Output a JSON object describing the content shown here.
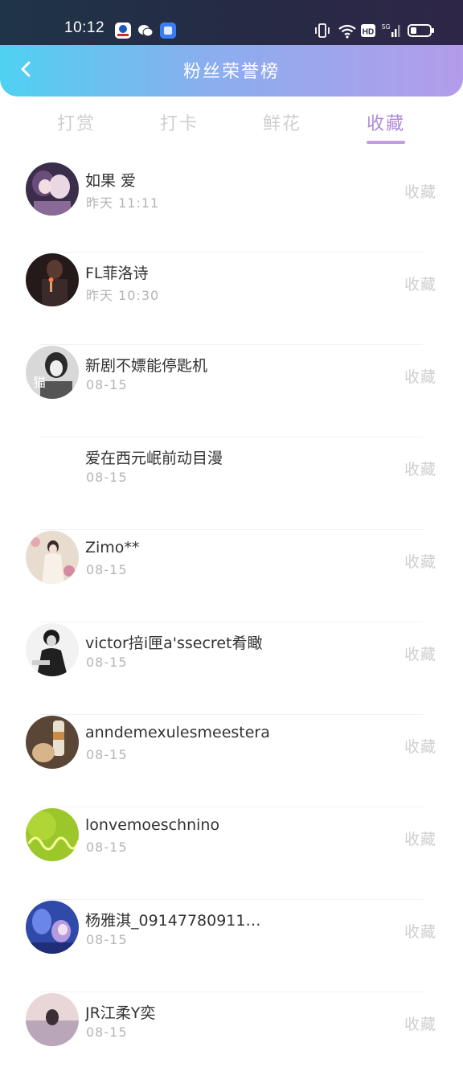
{
  "status_bar": {
    "time": "10:12",
    "left_icons": [
      "bank-app-icon",
      "wechat-icon",
      "blue-app-icon"
    ],
    "right_icons": [
      "vibrate-icon",
      "wifi-icon",
      "hd-icon",
      "signal-5g-icon",
      "battery-icon"
    ],
    "hd_label": "HD",
    "network_label": "5G"
  },
  "header": {
    "title": "粉丝荣誉榜",
    "back_icon": "chevron-left-icon"
  },
  "tabs": [
    {
      "label": "打赏",
      "active": false
    },
    {
      "label": "打卡",
      "active": false
    },
    {
      "label": "鲜花",
      "active": false
    },
    {
      "label": "收藏",
      "active": true
    }
  ],
  "colors": {
    "accent": "#b08ad8",
    "header_gradient_start": "#4fd1f2",
    "header_gradient_end": "#b39cea",
    "inactive_text": "#cfcfcf"
  },
  "list": [
    {
      "name": "如果 爱",
      "time": "昨天 11:11",
      "action": "收藏",
      "avatar": "avatar-anime-duo"
    },
    {
      "name": "FL菲洛诗",
      "time": "昨天 10:30",
      "action": "收藏",
      "avatar": "avatar-dark-candle"
    },
    {
      "name": "新剧不嫖能停匙机",
      "time": "08-15",
      "action": "收藏",
      "avatar": "avatar-bw-girl"
    },
    {
      "name": "爱在西元岷前动目漫",
      "time": "08-15",
      "action": "收藏",
      "avatar": "avatar-none"
    },
    {
      "name": "Zimo**",
      "time": "08-15",
      "action": "收藏",
      "avatar": "avatar-floral-girl"
    },
    {
      "name": "victor掊i匣a'ssecret肴瞰",
      "time": "08-15",
      "action": "收藏",
      "avatar": "avatar-bw-man"
    },
    {
      "name": "anndemexulesmeestera",
      "time": "08-15",
      "action": "收藏",
      "avatar": "avatar-bottle"
    },
    {
      "name": "lonvemoeschnino",
      "time": "08-15",
      "action": "收藏",
      "avatar": "avatar-green-wave"
    },
    {
      "name": "杨雅淇_09147780911…",
      "time": "08-15",
      "action": "收藏",
      "avatar": "avatar-blue-anime"
    },
    {
      "name": "JR江柔Y奕",
      "time": "08-15",
      "action": "收藏",
      "avatar": "avatar-sunset-girl"
    }
  ]
}
